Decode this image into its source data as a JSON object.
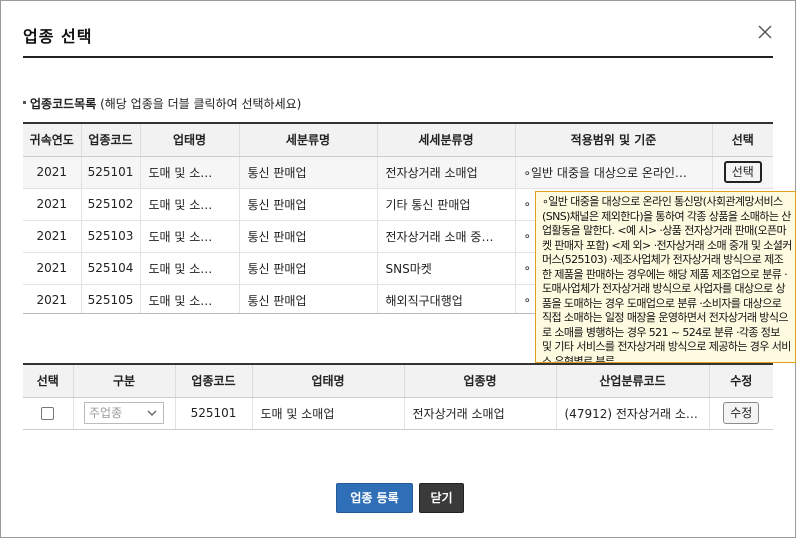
{
  "dialog": {
    "title": "업종 선택",
    "close_icon": "close-icon"
  },
  "section": {
    "label_strong": "업종코드목록",
    "label_hint": "(해당 업종을 더블 클릭하여 선택하세요)"
  },
  "code_table": {
    "headers": [
      "귀속연도",
      "업종코드",
      "업태명",
      "세분류명",
      "세세분류명",
      "적용범위 및 기준",
      "선택"
    ],
    "rows": [
      {
        "year": "2021",
        "code": "525101",
        "business_type": "도매 및 소…",
        "sub_class": "통신 판매업",
        "detail_class": "전자상거래 소매업",
        "scope": "∘일반 대중을 대상으로 온라인…",
        "select_label": "선택"
      },
      {
        "year": "2021",
        "code": "525102",
        "business_type": "도매 및 소…",
        "sub_class": "통신 판매업",
        "detail_class": "기타 통신 판매업",
        "scope": "∘",
        "select_label": ""
      },
      {
        "year": "2021",
        "code": "525103",
        "business_type": "도매 및 소…",
        "sub_class": "통신 판매업",
        "detail_class": "전자상거래 소매 중…",
        "scope": "∘",
        "select_label": ""
      },
      {
        "year": "2021",
        "code": "525104",
        "business_type": "도매 및 소…",
        "sub_class": "통신 판매업",
        "detail_class": "SNS마켓",
        "scope": "∘",
        "select_label": ""
      },
      {
        "year": "2021",
        "code": "525105",
        "business_type": "도매 및 소…",
        "sub_class": "통신 판매업",
        "detail_class": "해외직구대행업",
        "scope": "∘",
        "select_label": ""
      }
    ]
  },
  "tooltip": {
    "text": "∘일반 대중을 대상으로 온라인 통신망(사회관계망서비스(SNS)채널은 제외한다)을 통하여 각종 상품을 소매하는 산업활동을 말한다. <예 시> ·상품 전자상거래 판매(오픈마켓 판매자 포함) <제 외> ·전자상거래 소매 중개 및 소셜커머스(525103) ·제조사업체가 전자상거래 방식으로 제조한 제품을 판매하는 경우에는 해당 제품 제조업으로 분류 ·도매사업체가 전자상거래 방식으로 사업자를 대상으로 상품을 도매하는 경우 도매업으로 분류 ·소비자를 대상으로 직접 소매하는 일정 매장을 운영하면서 전자상거래 방식으로 소매를 병행하는 경우 521 ~ 524로 분류 ·각종 정보 및 기타 서비스를 전자상거래 방식으로 제공하는 경우 서비스 유형별로 분류"
  },
  "selected_table": {
    "headers": [
      "선택",
      "구분",
      "업종코드",
      "업태명",
      "업종명",
      "산업분류코드",
      "수정"
    ],
    "rows": [
      {
        "category_placeholder": "주업종",
        "code": "525101",
        "business_type": "도매 및 소매업",
        "industry_name": "전자상거래 소매업",
        "industry_code": "(47912) 전자상거래 소…",
        "edit_label": "수정"
      }
    ]
  },
  "actions": {
    "register_label": "업종 등록",
    "close_label": "닫기"
  }
}
